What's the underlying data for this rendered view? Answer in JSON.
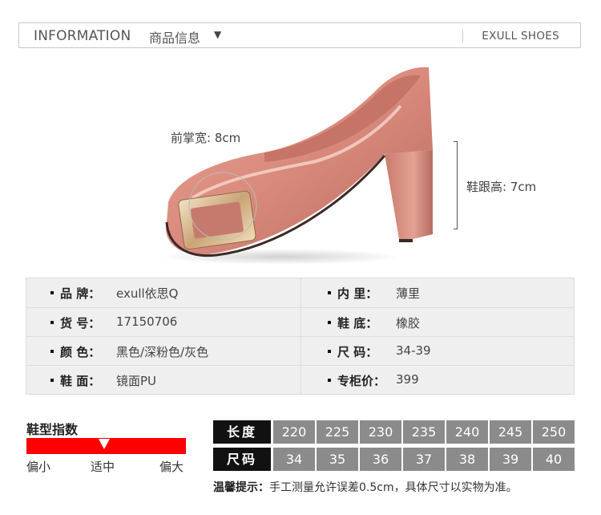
{
  "header": {
    "title": "INFORMATION",
    "cn_title": "商品信息",
    "dropdown_arrow": "▼",
    "brand": "EXULL SHOES"
  },
  "measurements": {
    "forefoot_width": "前掌宽: 8cm",
    "heel_height": "鞋跟高: 7cm"
  },
  "specs": {
    "left": [
      {
        "key": "品  牌：",
        "value": "exull依思Q"
      },
      {
        "key": "货  号：",
        "value": "17150706"
      },
      {
        "key": "颜  色：",
        "value": "黑色/深粉色/灰色"
      },
      {
        "key": "鞋  面：",
        "value": "镜面PU"
      }
    ],
    "right": [
      {
        "key": "内  里：",
        "value": "薄里"
      },
      {
        "key": "鞋  底：",
        "value": "橡胶"
      },
      {
        "key": "尺  码：",
        "value": "34-39"
      },
      {
        "key": "专柜价：",
        "value": "399"
      }
    ]
  },
  "fit_index": {
    "title": "鞋型指数",
    "small": "偏小",
    "mid": "适中",
    "big": "偏大",
    "position": "适中",
    "bar_color": "#ff0000"
  },
  "size_table": {
    "length_label": "长度",
    "size_label": "尺码",
    "lengths": [
      "220",
      "225",
      "230",
      "235",
      "240",
      "245",
      "250"
    ],
    "sizes": [
      "34",
      "35",
      "36",
      "37",
      "38",
      "39",
      "40"
    ],
    "note_label": "温馨提示：",
    "note_text": "手工测量允许误差0.5cm，具体尺寸以实物为准。"
  },
  "colors": {
    "shoe": "#d98a7c",
    "header_head_bg": "#111111",
    "size_cell_bg": "#8b8b8b"
  }
}
